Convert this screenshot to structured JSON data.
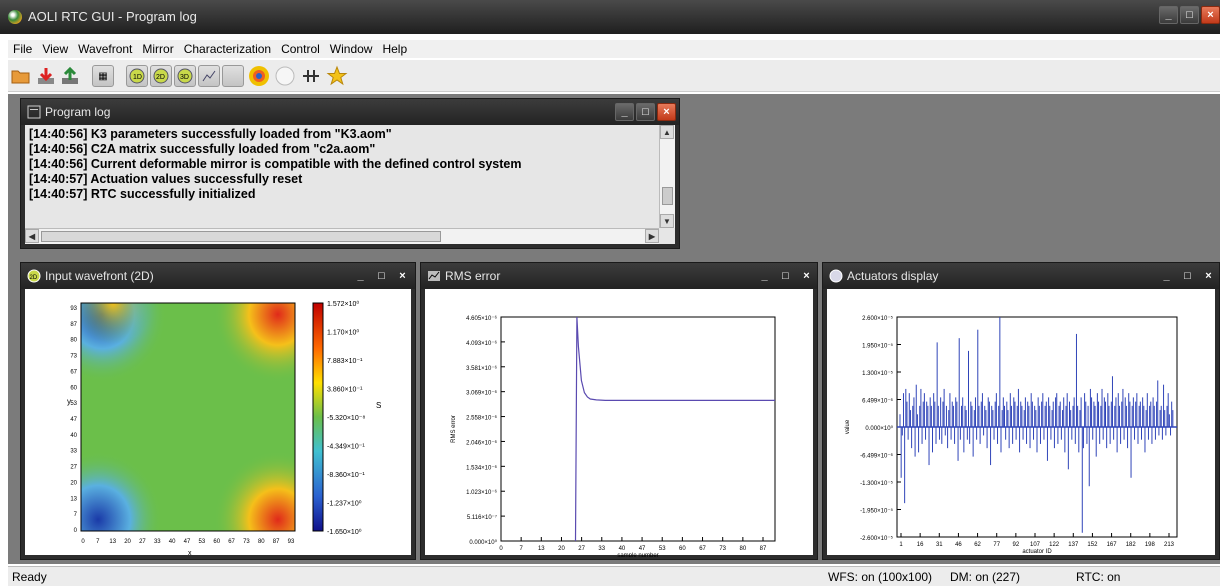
{
  "app": {
    "title": "AOLI RTC GUI - Program log"
  },
  "menu": {
    "items": [
      {
        "label": "File",
        "u": "F",
        "rest": "ile"
      },
      {
        "label": "View",
        "u": "V",
        "rest": "iew"
      },
      {
        "label": "Wavefront",
        "u": "",
        "rest": "Wavefront"
      },
      {
        "label": "Mirror",
        "u": "",
        "rest": "Mirror"
      },
      {
        "label": "Characterization",
        "u": "",
        "rest": "Characterization"
      },
      {
        "label": "Control",
        "u": "",
        "rest": "Control"
      },
      {
        "label": "Window",
        "u": "W",
        "rest": "indow"
      },
      {
        "label": "Help",
        "u": "H",
        "rest": "elp"
      }
    ]
  },
  "toolbar": {
    "buttons": [
      "open-folder-icon",
      "download-icon",
      "export-icon",
      "grid-icon",
      "wavefront-1d-icon",
      "wavefront-2d-icon",
      "wavefront-3d-icon",
      "plot-icon",
      "blank-icon",
      "color-map-icon",
      "circle-icon",
      "link-icon",
      "star-icon"
    ]
  },
  "program_log": {
    "title": "Program log",
    "lines": [
      "[14:40:56] K3 parameters successfully loaded from \"K3.aom\"",
      "[14:40:56] C2A matrix successfully loaded from \"c2a.aom\"",
      "[14:40:56] Current deformable mirror is compatible with the defined control system",
      "[14:40:57] Actuation values successfully reset",
      "[14:40:57] RTC successfully initialized"
    ]
  },
  "windows": {
    "wavefront": {
      "title": "Input wavefront (2D)",
      "colorbar": [
        "1.572×10⁰",
        "1.170×10⁰",
        "7.883×10⁻¹",
        "3.860×10⁻¹",
        "-5.320×10⁻⁸",
        "-4.349×10⁻¹",
        "-8.360×10⁻¹",
        "-1.237×10⁰",
        "-1.650×10⁰"
      ],
      "y_ticks": [
        "93",
        "87",
        "80",
        "73",
        "67",
        "60",
        "53",
        "47",
        "40",
        "33",
        "27",
        "20",
        "13",
        "7",
        "0"
      ],
      "x_ticks": [
        "0",
        "7",
        "13",
        "20",
        "27",
        "33",
        "40",
        "47",
        "53",
        "60",
        "67",
        "73",
        "80",
        "87",
        "93"
      ],
      "colorbar_side_label": "S",
      "ylabel": "y",
      "xlabel": "x"
    },
    "rms": {
      "title": "RMS error",
      "xlabel": "sample number",
      "ylabel": "RMS error"
    },
    "actuators": {
      "title": "Actuators display",
      "xlabel": "actuator ID",
      "ylabel": "value"
    }
  },
  "chart_data": [
    {
      "type": "line",
      "title": "",
      "xlabel": "sample number",
      "ylabel": "RMS error",
      "ylim": [
        0,
        4.605e-06
      ],
      "xlim": [
        0,
        92
      ],
      "y_ticks": [
        "4.605×10⁻⁶",
        "4.093×10⁻⁶",
        "3.581×10⁻⁶",
        "3.069×10⁻⁶",
        "2.558×10⁻⁶",
        "2.046×10⁻⁶",
        "1.534×10⁻⁶",
        "1.023×10⁻⁶",
        "5.116×10⁻⁷",
        "0.000×10⁰"
      ],
      "x_ticks": [
        "0",
        "7",
        "13",
        "20",
        "27",
        "33",
        "40",
        "47",
        "53",
        "60",
        "67",
        "73",
        "80",
        "87"
      ],
      "x": [
        25,
        25.5,
        26,
        27,
        28,
        29,
        30,
        32,
        35,
        40,
        50,
        60,
        70,
        80,
        92
      ],
      "y": [
        0,
        4.605e-06,
        4e-06,
        3.3e-06,
        3.05e-06,
        2.96e-06,
        2.92e-06,
        2.9e-06,
        2.89e-06,
        2.89e-06,
        2.89e-06,
        2.89e-06,
        2.89e-06,
        2.89e-06,
        2.89e-06
      ]
    },
    {
      "type": "bar",
      "title": "",
      "xlabel": "actuator ID",
      "ylabel": "value",
      "ylim": [
        -2.6e-05,
        2.6e-05
      ],
      "y_ticks": [
        "2.600×10⁻⁵",
        "1.950×10⁻⁵",
        "1.300×10⁻⁵",
        "6.499×10⁻⁶",
        "0.000×10⁰",
        "-6.499×10⁻⁶",
        "-1.300×10⁻⁵",
        "-1.950×10⁻⁵",
        "-2.600×10⁻⁵"
      ],
      "x_ticks": [
        "1",
        "16",
        "31",
        "46",
        "62",
        "77",
        "92",
        "107",
        "122",
        "137",
        "152",
        "167",
        "182",
        "198",
        "213"
      ],
      "values": [
        3,
        -12,
        -2,
        8,
        -18,
        9,
        6,
        -3,
        8,
        4,
        -5,
        5,
        7,
        -7,
        10,
        3,
        -6,
        5,
        9,
        -4,
        6,
        8,
        -3,
        6,
        5,
        -9,
        7,
        5,
        -6,
        8,
        6,
        -4,
        20,
        5,
        -3,
        7,
        -4,
        6,
        9,
        -2,
        5,
        -5,
        4,
        8,
        -3,
        6,
        5,
        -4,
        7,
        6,
        -8,
        21,
        -3,
        5,
        7,
        -6,
        5,
        4,
        -3,
        18,
        -4,
        6,
        5,
        -7,
        4,
        7,
        -3,
        23,
        5,
        -4,
        6,
        8,
        -2,
        5,
        4,
        -5,
        7,
        6,
        -9,
        5,
        4,
        -3,
        6,
        8,
        -4,
        5,
        26,
        -6,
        4,
        7,
        5,
        -3,
        6,
        4,
        -5,
        8,
        5,
        -4,
        7,
        6,
        -3,
        5,
        9,
        -6,
        6,
        5,
        -3,
        4,
        7,
        -4,
        6,
        5,
        -5,
        8,
        6,
        -3,
        5,
        4,
        -6,
        7,
        5,
        -4,
        6,
        8,
        -3,
        5,
        6,
        -8,
        7,
        5,
        -3,
        4,
        6,
        -5,
        7,
        8,
        -4,
        5,
        6,
        -3,
        4,
        7,
        -6,
        5,
        8,
        -10,
        6,
        4,
        -3,
        5,
        7,
        -4,
        22,
        5,
        -6,
        4,
        7,
        -25,
        -5,
        8,
        6,
        -4,
        5,
        -14,
        9,
        7,
        -3,
        6,
        5,
        -7,
        8,
        6,
        -4,
        5,
        9,
        -3,
        7,
        6,
        -5,
        8,
        5,
        -4,
        6,
        12,
        -3,
        5,
        7,
        -6,
        8,
        5,
        -4,
        6,
        9,
        -3,
        7,
        5,
        -5,
        8,
        6,
        -12,
        5,
        7,
        -3,
        6,
        8,
        -4,
        5,
        6,
        -3,
        7,
        5,
        -6,
        4,
        8,
        -3,
        5,
        6,
        -4,
        7,
        5,
        -3,
        6,
        11,
        -2,
        4,
        5,
        -3,
        10,
        4,
        -2,
        5,
        8,
        3,
        -2,
        6,
        4
      ]
    }
  ],
  "status": {
    "ready": "Ready",
    "wfs": "WFS: on (100x100)",
    "dm": "DM: on (227)",
    "rtc": "RTC: on"
  }
}
